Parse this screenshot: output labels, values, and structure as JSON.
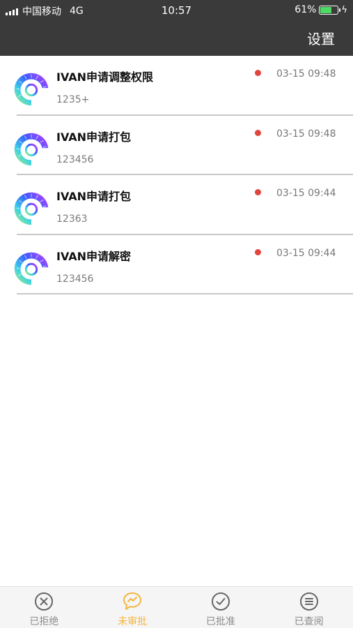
{
  "status_bar": {
    "carrier": "中国移动",
    "network": "4G",
    "time": "10:57",
    "battery": "61%",
    "battery_level": 0.61
  },
  "header": {
    "settings_label": "设置"
  },
  "colors": {
    "header_bg": "#3a3a3a",
    "unread_dot": "#e0463f",
    "tab_active": "#f4b53f",
    "tab_inactive": "#8a8a8a"
  },
  "requests": [
    {
      "title": "IVAN申请调整权限",
      "subtitle": "1235+",
      "time": "03-15 09:48",
      "unread": true
    },
    {
      "title": "IVAN申请打包",
      "subtitle": "123456",
      "time": "03-15 09:48",
      "unread": true
    },
    {
      "title": "IVAN申请打包",
      "subtitle": "12363",
      "time": "03-15 09:44",
      "unread": true
    },
    {
      "title": "IVAN申请解密",
      "subtitle": "123456",
      "time": "03-15 09:44",
      "unread": true
    }
  ],
  "tabs": [
    {
      "label": "已拒绝",
      "icon": "x-circle-icon",
      "active": false
    },
    {
      "label": "未审批",
      "icon": "chat-bubble-icon",
      "active": true
    },
    {
      "label": "已批准",
      "icon": "check-circle-icon",
      "active": false
    },
    {
      "label": "已查阅",
      "icon": "list-circle-icon",
      "active": false
    }
  ]
}
